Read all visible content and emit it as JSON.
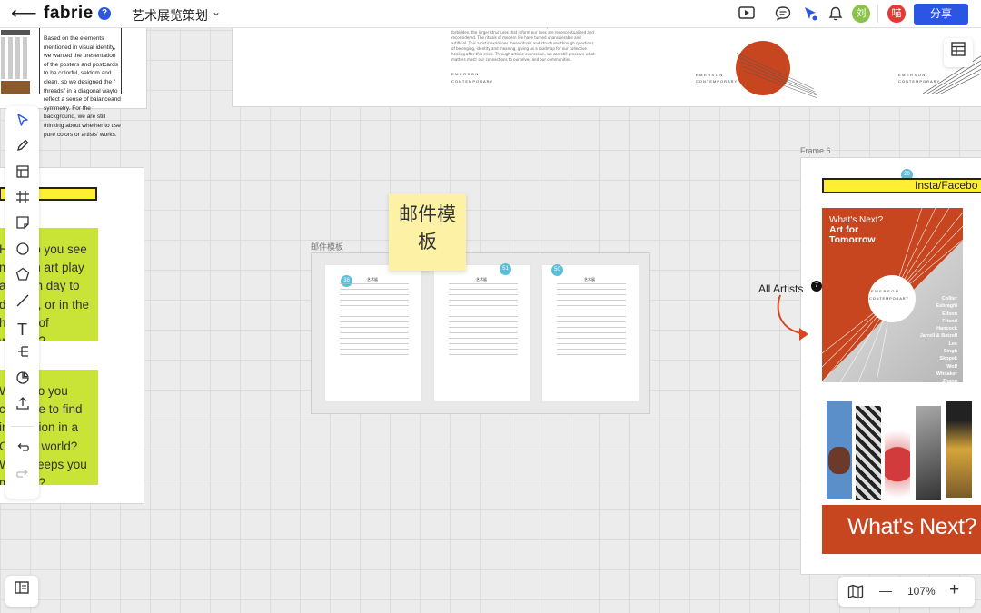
{
  "header": {
    "back_icon": "arrow-left-icon",
    "logo": "fabrie",
    "help": "?",
    "project_title": "艺术展览策划",
    "chevron": "⌄",
    "icons": [
      "present-icon",
      "comment-icon",
      "cursor-follow-icon",
      "bell-icon"
    ],
    "avatars": [
      {
        "label": "刘",
        "color": "#8bc34a"
      },
      {
        "label": "喵",
        "color": "#e53935"
      }
    ],
    "share_label": "分享"
  },
  "toolbar": {
    "tools": [
      "select",
      "pen",
      "layout",
      "frame",
      "sticky-note",
      "circle",
      "polygon",
      "line",
      "text",
      "mindmap",
      "sticker",
      "upload",
      "undo",
      "redo"
    ],
    "icons": [
      "▷",
      "✎",
      "▤",
      "#",
      "▱",
      "○",
      "⬠",
      "╱",
      "T",
      "⋲",
      "◔",
      "⇪",
      "↶",
      "↷"
    ]
  },
  "left_frame": {
    "text": "Based on the elements mentioned in visual identity, we wanted the presentation of the posters and postcards to be colorful, seldom and clean, so we designed the \" threads\" in a diagonal wayto reflect a sense of balanceand symmetry. For the background, we are still thinking about whether to use pure colors or artists' works.",
    "green_block_1": "How do you see modern art play a role in day to day life, or in the history of women?",
    "green_block_2": "What do you continue to find inspiration in a COVID world? What keeps you moving?"
  },
  "top_frame": {
    "paragraph": "understood under our current circumstances. As simple routines are forbidden, the larger structures that inform our lives are reconceptualized and reconsidered. The rituals of modern life have turned unanswerable and artificial. This artistic examines these rituals and structures through questions of belonging, identity and meaning, giving us a roadmap for our collective healing after this crisis. Through artistic expression, we can still preserve what matters most: our connections to ourselves and our communities.",
    "brand_top": "EMERSON",
    "brand_bottom": "CONTEMPORARY"
  },
  "sticky_note": {
    "text": "邮件模板"
  },
  "email_group": {
    "label": "邮件模板",
    "cards": [
      {
        "badge": "38",
        "title": "艺术展"
      },
      {
        "badge": "51",
        "title": "艺术展"
      },
      {
        "badge": "50",
        "title": "艺术展"
      }
    ]
  },
  "frame6": {
    "label": "Frame 6",
    "badge": "20",
    "banner_text": "Insta/Facebo",
    "poster": {
      "headline_small": "What's Next?",
      "headline_big": "Art for Tomorrow",
      "brand_top": "EMERSON",
      "brand_bottom": "CONTEMPORARY",
      "artists": [
        "Collier",
        "Eshraghi",
        "Edson",
        "Friend",
        "Hancock",
        "Jarrell & Batzell",
        "Lee",
        "Singh",
        "Skopek",
        "Wolf",
        "Whitaker",
        "Zhang"
      ]
    },
    "bottom_banner": "What's Next? A",
    "annotation": {
      "label": "All Artists",
      "count": "7"
    },
    "colors": {
      "accent": "#c8461f",
      "banner_yellow": "#ffee33",
      "green": "#c9e436"
    }
  },
  "zoom": {
    "map_icon": "map-icon",
    "minus": "—",
    "value": "107%",
    "plus": "+"
  }
}
